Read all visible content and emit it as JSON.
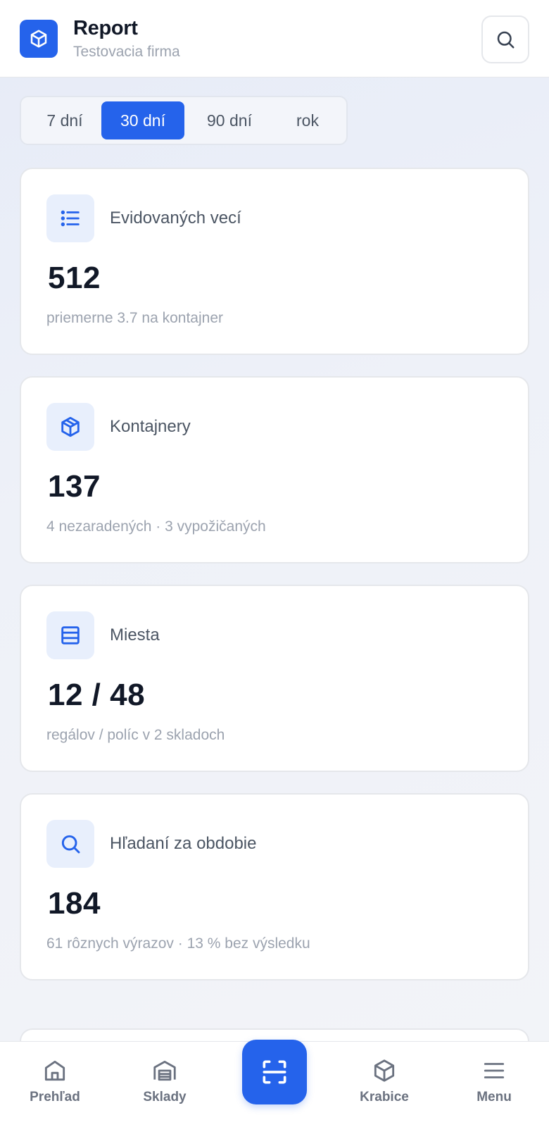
{
  "header": {
    "app_icon": "cube-icon",
    "title": "Report",
    "subtitle": "Testovacia firma",
    "search_icon": "search-icon"
  },
  "period_selector": {
    "options": [
      "7 dní",
      "30 dní",
      "90 dní",
      "rok"
    ],
    "selected": "30 dní"
  },
  "stats": [
    {
      "icon": "list-icon",
      "label": "Evidovaných vecí",
      "value": "512",
      "sub": "priemerne 3.7 na kontajner"
    },
    {
      "icon": "package-icon",
      "label": "Kontajnery",
      "value": "137",
      "sub": "4 nezaradených · 3 vypožičaných"
    },
    {
      "icon": "shelves-icon",
      "label": "Miesta",
      "value": "12 / 48",
      "sub": "regálov / políc v 2 skladoch"
    },
    {
      "icon": "search-icon",
      "label": "Hľadaní za obdobie",
      "value": "184",
      "sub": "61 rôznych výrazov · 13 % bez výsledku"
    }
  ],
  "bottom_nav": {
    "items": [
      {
        "icon": "home-icon",
        "label": "Prehľad"
      },
      {
        "icon": "warehouse-icon",
        "label": "Sklady"
      },
      {
        "icon": "box-icon",
        "label": "Krabice"
      },
      {
        "icon": "menu-icon",
        "label": "Menu"
      }
    ],
    "scan_icon": "scan-icon"
  },
  "colors": {
    "accent": "#2563eb",
    "icon_bg": "#e8effc",
    "text_primary": "#111827",
    "text_muted": "#9ca3af"
  }
}
